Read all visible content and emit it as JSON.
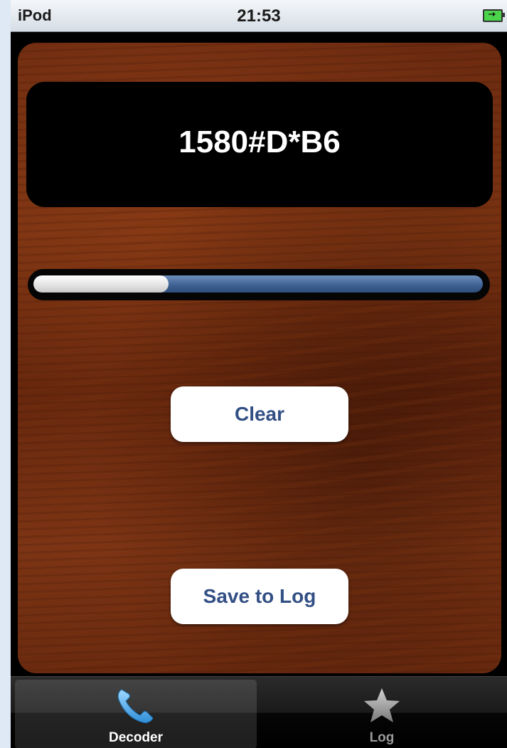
{
  "status_bar": {
    "carrier": "iPod",
    "time": "21:53",
    "battery_icon": "battery-charging-icon"
  },
  "display": {
    "decoded_text": "1580#D*B6"
  },
  "progress": {
    "level_fraction": 0.3
  },
  "buttons": {
    "clear_label": "Clear",
    "save_label": "Save to Log"
  },
  "tab_bar": {
    "tabs": [
      {
        "label": "Decoder",
        "icon": "phone-icon",
        "selected": true
      },
      {
        "label": "Log",
        "icon": "star-icon",
        "selected": false
      }
    ]
  },
  "colors": {
    "button_text": "#324f84",
    "progress_blue": "#3d5f91",
    "tab_selected_icon": "#5bb5f0"
  }
}
